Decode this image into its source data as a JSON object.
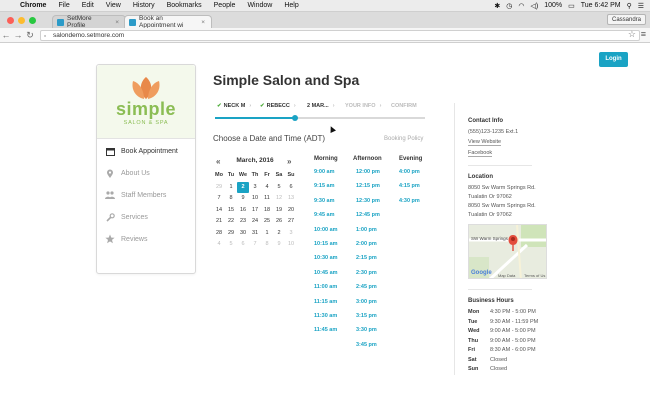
{
  "menubar": {
    "app": "Chrome",
    "items": [
      "File",
      "Edit",
      "View",
      "History",
      "Bookmarks",
      "People",
      "Window",
      "Help"
    ],
    "battery": "100%",
    "clock": "Tue 6:42 PM"
  },
  "tabs": [
    {
      "title": "SetMore Profile",
      "close": "×"
    },
    {
      "title": "Book an Appointment wi",
      "close": "×"
    }
  ],
  "profile_button": "Cassandra",
  "url": "salondemo.setmore.com",
  "login_label": "Login",
  "logo": {
    "word": "simple",
    "sub": "SALON & SPA"
  },
  "sidebar": {
    "items": [
      {
        "label": "Book Appointment",
        "icon": "calendar-icon"
      },
      {
        "label": "About Us",
        "icon": "location-pin-icon"
      },
      {
        "label": "Staff Members",
        "icon": "people-icon"
      },
      {
        "label": "Services",
        "icon": "wrench-icon"
      },
      {
        "label": "Reviews",
        "icon": "star-icon"
      }
    ]
  },
  "business_name": "Simple Salon and Spa",
  "steps": [
    {
      "label": "NECK M",
      "done": true
    },
    {
      "label": "REBECC",
      "done": true
    },
    {
      "label": "2 MAR...",
      "done": false
    },
    {
      "label": "YOUR INFO",
      "done": false
    },
    {
      "label": "CONFIRM",
      "done": false
    }
  ],
  "progress_fraction": 0.38,
  "choose_label": "Choose a Date and Time (ADT)",
  "booking_policy": "Booking Policy",
  "calendar": {
    "month": "March, 2016",
    "prev": "«",
    "next": "»",
    "dow": [
      "Mo",
      "Tu",
      "We",
      "Th",
      "Fr",
      "Sa",
      "Su"
    ],
    "days": [
      "29",
      "1",
      "2",
      "3",
      "4",
      "5",
      "6",
      "7",
      "8",
      "9",
      "10",
      "11",
      "12",
      "13",
      "14",
      "15",
      "16",
      "17",
      "18",
      "19",
      "20",
      "21",
      "22",
      "23",
      "24",
      "25",
      "26",
      "27",
      "28",
      "29",
      "30",
      "31",
      "1",
      "2",
      "3",
      "4",
      "5",
      "6",
      "7",
      "8",
      "9",
      "10"
    ],
    "muted_indices": [
      0,
      12,
      13,
      34,
      35,
      36,
      37,
      38,
      39,
      40,
      41
    ],
    "selected_index": 2
  },
  "slots": {
    "morning": {
      "label": "Morning",
      "times": [
        "9:00 am",
        "9:15 am",
        "9:30 am",
        "9:45 am",
        "10:00 am",
        "10:15 am",
        "10:30 am",
        "10:45 am",
        "11:00 am",
        "11:15 am",
        "11:30 am",
        "11:45 am"
      ]
    },
    "afternoon": {
      "label": "Afternoon",
      "times": [
        "12:00 pm",
        "12:15 pm",
        "12:30 pm",
        "12:45 pm",
        "1:00 pm",
        "2:00 pm",
        "2:15 pm",
        "2:30 pm",
        "2:45 pm",
        "3:00 pm",
        "3:15 pm",
        "3:30 pm",
        "3:45 pm"
      ]
    },
    "evening": {
      "label": "Evening",
      "times": [
        "4:00 pm",
        "4:15 pm",
        "4:30 pm"
      ]
    }
  },
  "contact": {
    "heading": "Contact Info",
    "phone": "(555)123-1235 Ext.1",
    "website": "View Website",
    "facebook": "Facebook"
  },
  "location": {
    "heading": "Location",
    "line1": "8050 Sw Warm Springs Rd.",
    "line2": "Tualatin Or 97062",
    "line3": "8050 Sw Warm Springs Rd.",
    "line4": "Tualatin Or 97062",
    "map_street": "SW Warm Springs",
    "map_logo": "Google",
    "map_data": "Map Data",
    "map_terms": "Terms of Us"
  },
  "hours": {
    "heading": "Business Hours",
    "rows": [
      {
        "day": "Mon",
        "time": "4:30 PM - 5:00 PM"
      },
      {
        "day": "Tue",
        "time": "9:30 AM - 11:59 PM"
      },
      {
        "day": "Wed",
        "time": "9:00 AM - 5:00 PM"
      },
      {
        "day": "Thu",
        "time": "9:00 AM - 5:00 PM"
      },
      {
        "day": "Fri",
        "time": "8:30 AM - 6:00 PM"
      },
      {
        "day": "Sat",
        "time": "Closed"
      },
      {
        "day": "Sun",
        "time": "Closed"
      }
    ]
  },
  "colors": {
    "accent": "#1aa3c4",
    "check": "#4fae3b",
    "logo_green": "#8bbd54",
    "logo_orange": "#e8894a"
  }
}
